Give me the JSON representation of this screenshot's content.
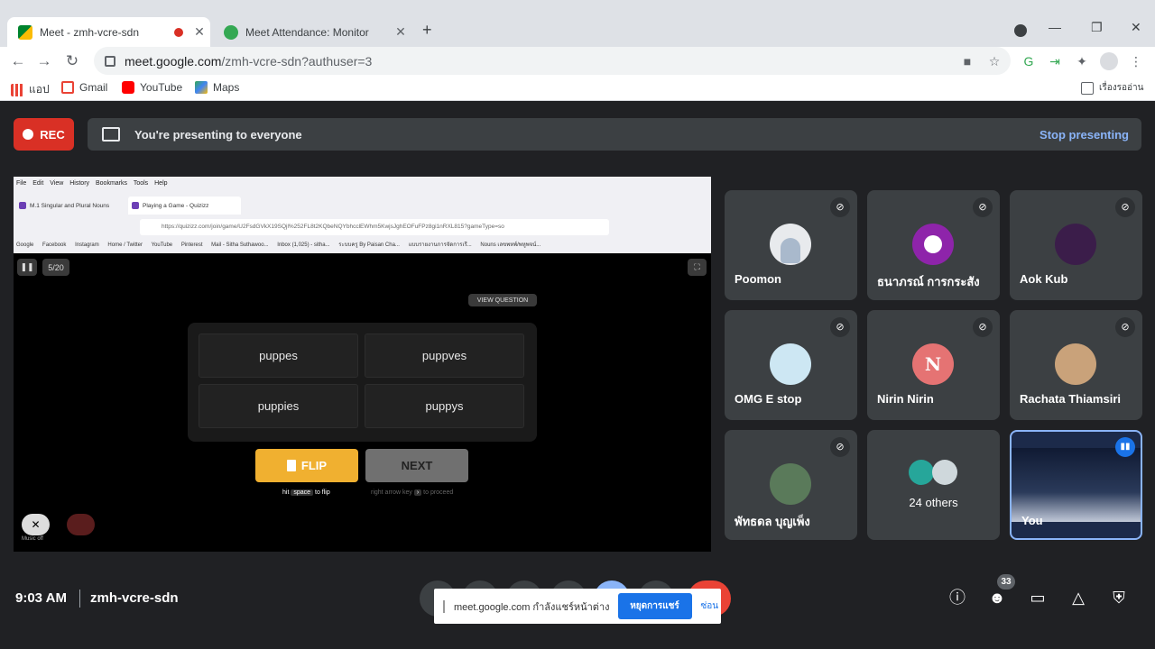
{
  "browser": {
    "tabs": [
      {
        "title": "Meet - zmh-vcre-sdn"
      },
      {
        "title": "Meet Attendance: Monitor"
      }
    ],
    "url_host": "meet.google.com",
    "url_path": "/zmh-vcre-sdn?authuser=3",
    "bookmarks": [
      "แอป",
      "Gmail",
      "YouTube",
      "Maps"
    ],
    "reading_list": "เรื่องรออ่าน"
  },
  "meet": {
    "rec_label": "REC",
    "presenting_msg": "You're presenting to everyone",
    "stop_presenting": "Stop presenting",
    "clock": "9:03 AM",
    "meeting_code": "zmh-vcre-sdn",
    "participant_count": "33",
    "share_notice": {
      "text": "meet.google.com กำลังแชร์หน้าต่าง",
      "stop_label": "หยุดการแชร์",
      "hide_label": "ซ่อน"
    }
  },
  "shared_screen": {
    "menu": [
      "File",
      "Edit",
      "View",
      "History",
      "Bookmarks",
      "Tools",
      "Help"
    ],
    "tabs": [
      "M.1 Singular and Plural Nouns",
      "Playing a Game - Quizizz"
    ],
    "url": "https://quizizz.com/join/game/U2FsdGVkX19SQjl%252FL8t2KQbeNQYbhcclEWhm5KwjsJghEOFuFPz8gi1nRXL815?gameType=so",
    "bookmarks": [
      "Google",
      "Facebook",
      "Instagram",
      "Home / Twitter",
      "YouTube",
      "Pinterest",
      "Mail - Sitha Suthawoo...",
      "Inbox (1,025) - sitha...",
      "ระบบครู By Paisan Cha...",
      "แบบรายงานการจัดการเรี...",
      "Nouns เลขพหพ์/พหูพจน์..."
    ],
    "quiz": {
      "progress": "5/20",
      "view_question": "VIEW QUESTION",
      "answers": [
        "puppes",
        "puppves",
        "puppies",
        "puppys"
      ],
      "flip_label": "FLIP",
      "next_label": "NEXT",
      "hint_flip_pre": "hit",
      "hint_flip_key": "space",
      "hint_flip_post": "to flip",
      "hint_next_pre": "right arrow key",
      "hint_next_key": "›",
      "hint_next_post": "to proceed",
      "music_label": "Music off"
    }
  },
  "participants": [
    {
      "name": "Poomon",
      "initial": "",
      "color": "#e8eaed"
    },
    {
      "name": "ธนาภรณ์ การกระสัง",
      "initial": "",
      "color": "#8e24aa"
    },
    {
      "name": "Aok Kub",
      "initial": "",
      "color": "#3b1d4a"
    },
    {
      "name": "OMG E stop",
      "initial": "",
      "color": "#cde7f3"
    },
    {
      "name": "Nirin Nirin",
      "initial": "N",
      "color": "#e57373"
    },
    {
      "name": "Rachata Thiamsiri",
      "initial": "",
      "color": "#c9a27a"
    },
    {
      "name": "พัทธดล บุญเพ็ง",
      "initial": "",
      "color": "#5a7a5a"
    },
    {
      "name": "24 others",
      "initial": "",
      "color": "#3c4043"
    },
    {
      "name": "You",
      "initial": "",
      "color": "#1c2a4a"
    }
  ]
}
